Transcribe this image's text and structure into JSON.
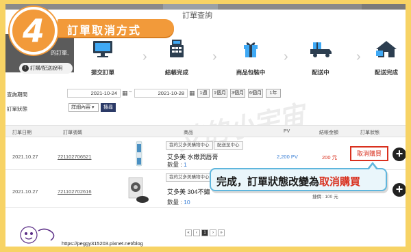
{
  "banner": {
    "step_number": "4",
    "title": "訂單取消方式"
  },
  "header": {
    "page_title": "訂單查詢",
    "panel_text": "的訂單,",
    "help_label": "訂購/配送說明"
  },
  "progress_steps": [
    {
      "label": "提交訂單",
      "icon": "monitor-icon"
    },
    {
      "label": "結帳完成",
      "icon": "cash-register-icon"
    },
    {
      "label": "商品包裝中",
      "icon": "gift-box-icon"
    },
    {
      "label": "配送中",
      "icon": "delivery-truck-icon"
    },
    {
      "label": "配送完成",
      "icon": "house-icon"
    }
  ],
  "filter": {
    "period_label": "查詢期間",
    "date_from": "2021-10-24",
    "date_to": "2021-10-28",
    "range_buttons": [
      "1週",
      "1個月",
      "3個月",
      "6個月",
      "1年"
    ],
    "status_label": "訂單狀態",
    "status_select": "詳細內容",
    "search_button": "搜尋"
  },
  "table": {
    "headers": [
      "訂單日期",
      "訂單號碼",
      "商品",
      "PV",
      "結帳金額",
      "訂單狀態"
    ],
    "rows": [
      {
        "date": "2021.10.27",
        "order_no": "721102706521",
        "btn_center": "我的艾多美購物中心",
        "btn_delivery": "配送至中心",
        "product": "艾多美 水嫩潤唇膏",
        "qty_label": "數量 : ",
        "qty": "1",
        "pv": "2,200 PV",
        "amount": "200 元",
        "status": "取消購買"
      },
      {
        "date": "2021.10.27",
        "order_no": "721102702616",
        "btn_center": "我的艾多美購物中心",
        "product": "艾多美 304不鏽",
        "qty_label": "數量 : ",
        "qty": "10",
        "amount_partial": "捷價 : 100 元"
      }
    ]
  },
  "callout": {
    "text_main": "完成，訂單狀態改變為",
    "text_highlight": "取消購買"
  },
  "pagination": {
    "first": "«",
    "prev": "‹",
    "current": "1",
    "next": "›",
    "last": "»"
  },
  "footer": {
    "url": "https://peggy315203.pixnet.net/blog",
    "logo_text": "艾的小宇宙"
  },
  "colors": {
    "frame": "#f7d365",
    "accent_orange": "#f29a3a",
    "cancel_red": "#d9301e",
    "callout_border": "#5fb6dd",
    "link_blue": "#3a7fd5"
  }
}
